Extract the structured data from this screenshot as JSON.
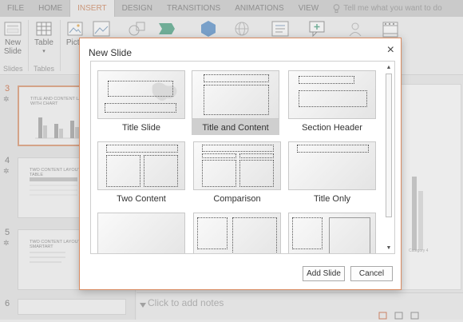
{
  "ribbon": {
    "tabs": [
      "FILE",
      "HOME",
      "INSERT",
      "DESIGN",
      "TRANSITIONS",
      "ANIMATIONS",
      "VIEW"
    ],
    "active_tab": "INSERT",
    "tell_me": "Tell me what you want to do",
    "new_slide_line1": "New",
    "new_slide_line2": "Slide",
    "table_label": "Table",
    "picture_label": "Pictu",
    "group_slides": "Slides",
    "group_tables": "Tables"
  },
  "slides_panel": {
    "slides": [
      {
        "number": "3",
        "title": "TITLE AND CONTENT LAYOUT WITH CHART"
      },
      {
        "number": "4",
        "title": "TWO CONTENT LAYOUT WITH TABLE"
      },
      {
        "number": "5",
        "title": "TWO CONTENT LAYOUT WITH SMARTART"
      },
      {
        "number": "6",
        "title": ""
      }
    ]
  },
  "main": {
    "notes_placeholder": "Click to add notes",
    "chart_category": "Category 4"
  },
  "dialog": {
    "title": "New Slide",
    "close_glyph": "×",
    "layouts": [
      "Title Slide",
      "Title and Content",
      "Section Header",
      "Two Content",
      "Comparison",
      "Title Only",
      "",
      "",
      ""
    ],
    "selected_layout": "Title and Content",
    "add_button": "Add Slide",
    "cancel_button": "Cancel"
  },
  "colors": {
    "accent": "#c8784c",
    "dialog_border": "#d98b61",
    "selected_layout_bg": "#cfcfcf"
  }
}
